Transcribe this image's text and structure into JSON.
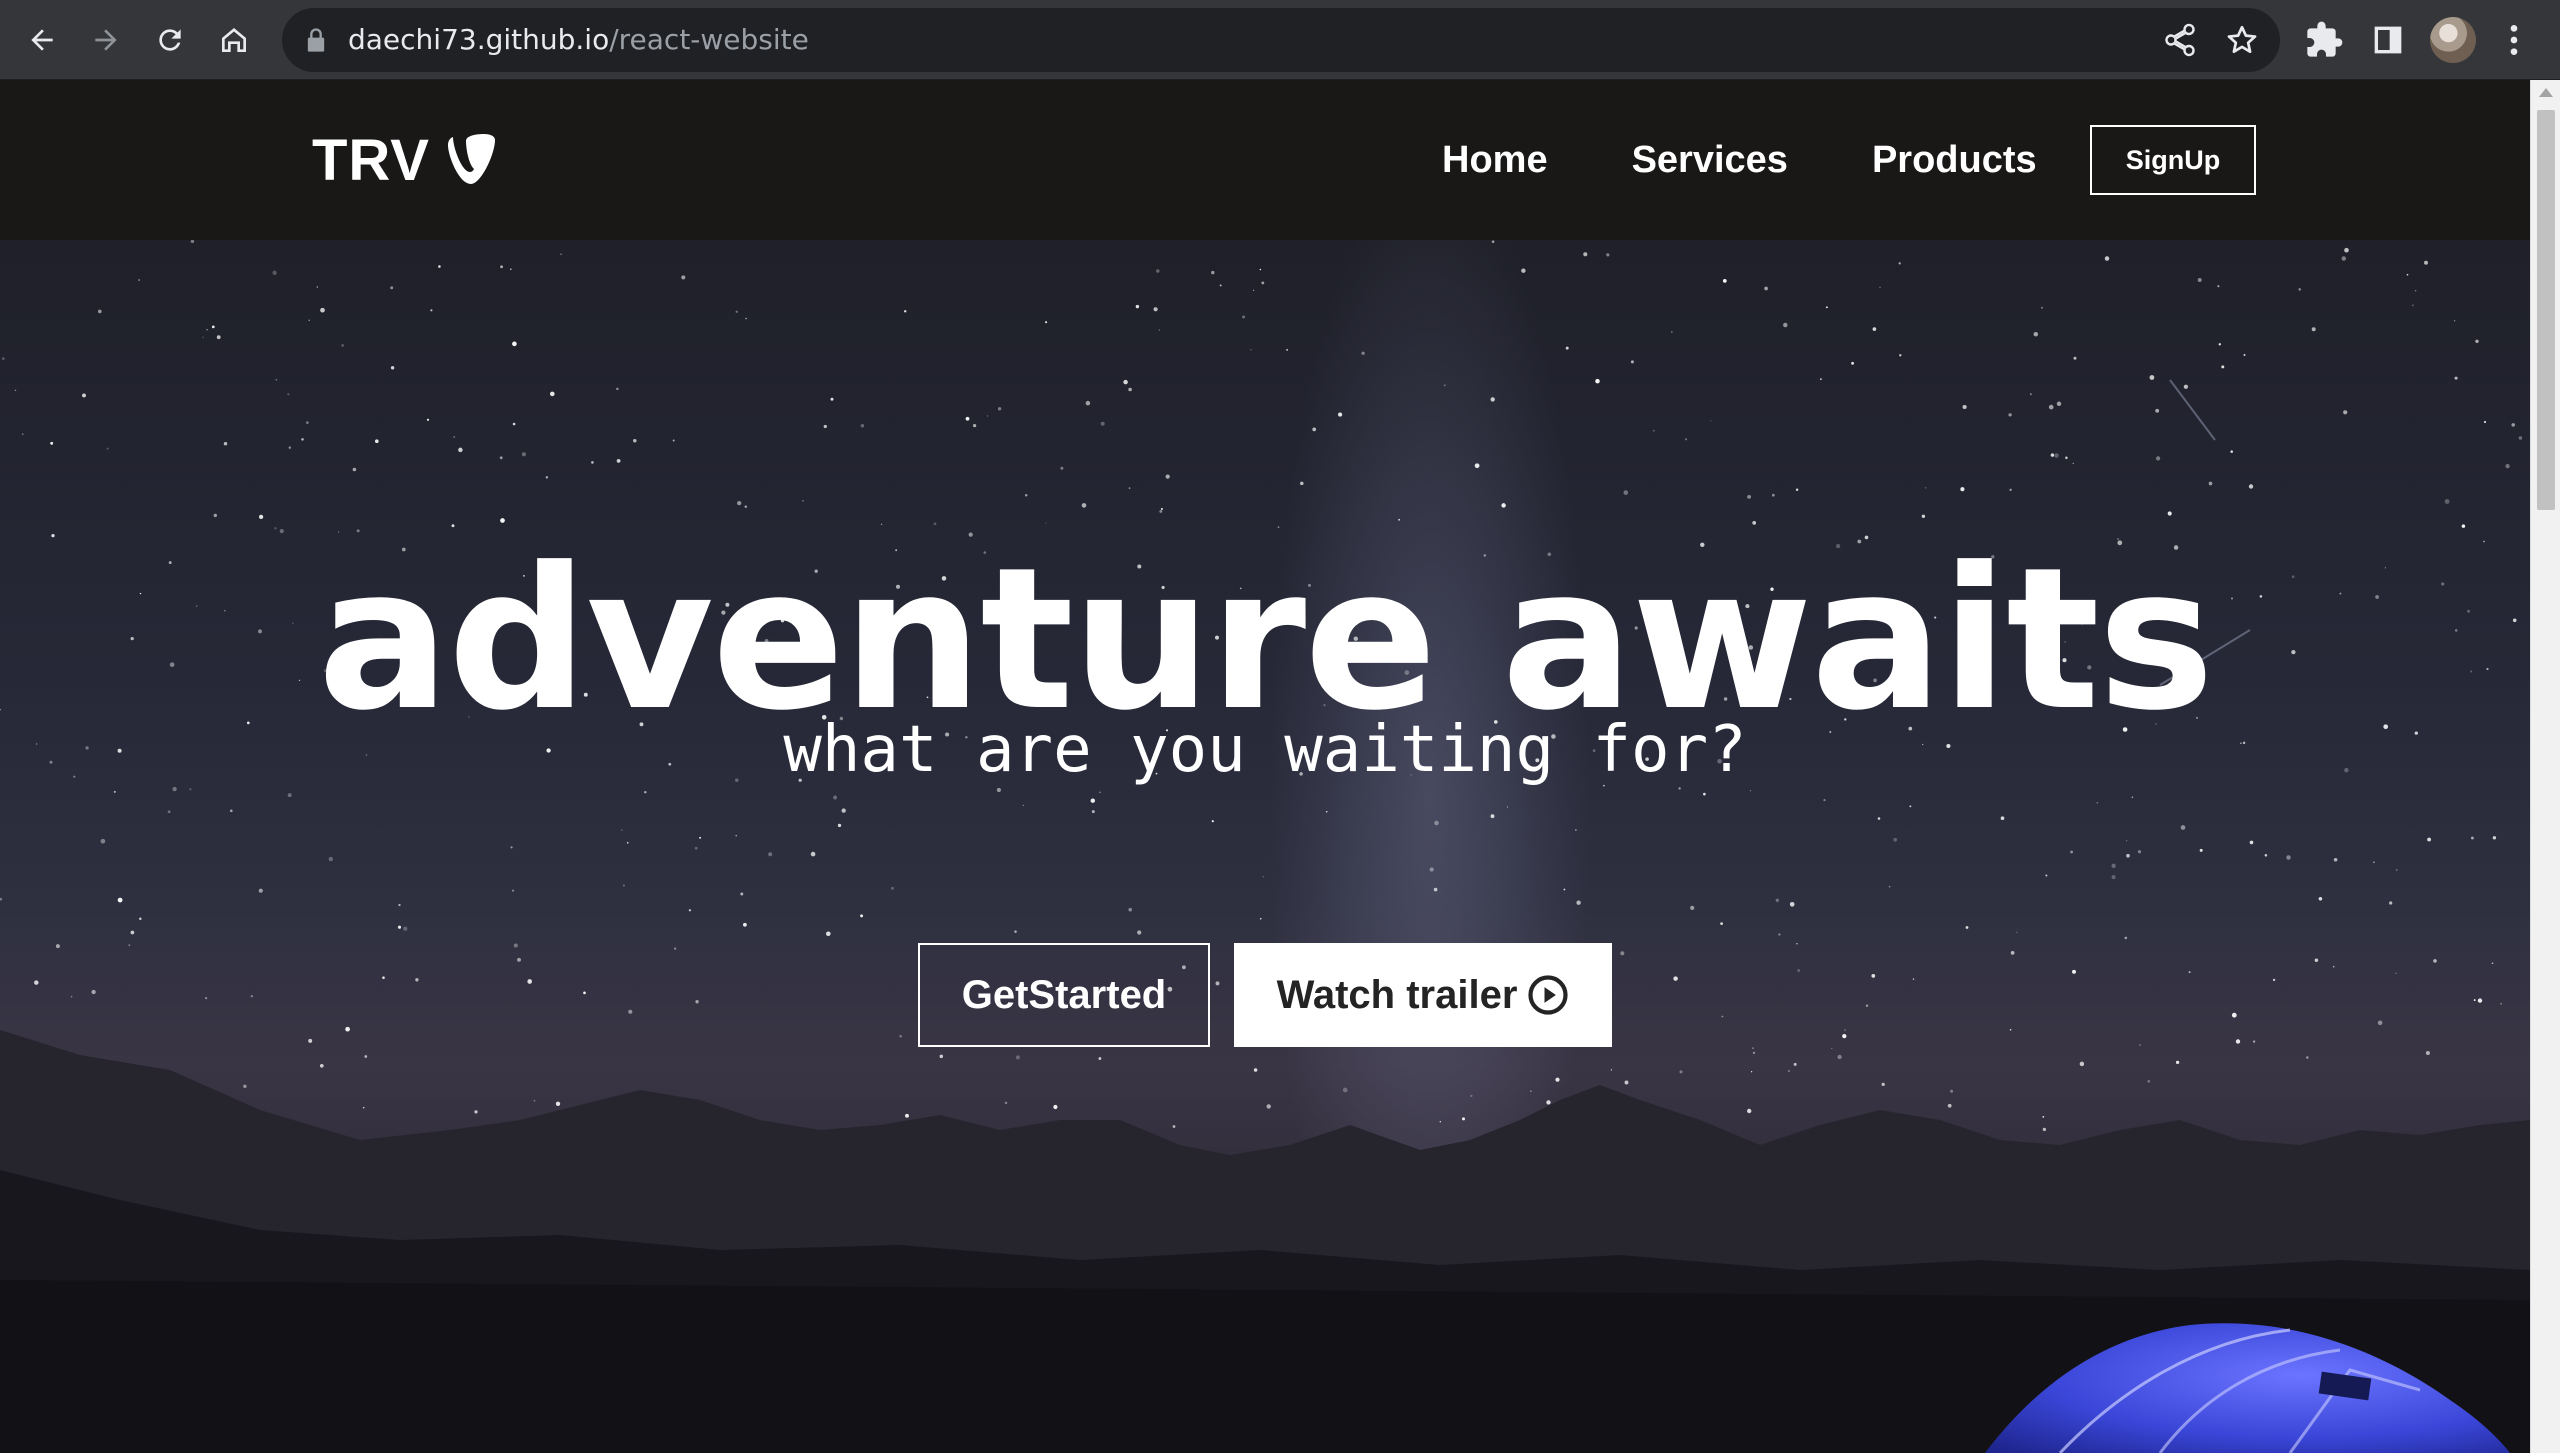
{
  "browser": {
    "url_host": "daechi73.github.io",
    "url_path": "/react-website",
    "icons": [
      "back-icon",
      "forward-icon",
      "reload-icon",
      "home-icon",
      "lock-icon",
      "share-icon",
      "bookmark-star-icon",
      "extensions-icon",
      "side-panel-icon",
      "profile-avatar",
      "menu-kebab-icon"
    ]
  },
  "navbar": {
    "logo_text": "TRV",
    "logo_icon": "typo3-logo-icon",
    "links": [
      {
        "label": "Home"
      },
      {
        "label": "Services"
      },
      {
        "label": "Products"
      }
    ],
    "signup_label": "SignUp"
  },
  "hero": {
    "title": "adventure awaits",
    "subtitle": "what are you waiting for?",
    "get_started_label": "GetStarted",
    "watch_trailer_label": "Watch trailer",
    "play_icon": "play-circle-icon"
  },
  "colors": {
    "chrome_bg": "#35363a",
    "omnibox_bg": "#202124",
    "navbar_bg": "#1a1817",
    "hero_text": "#ffffff",
    "tent_blue": "#3a46d8"
  }
}
